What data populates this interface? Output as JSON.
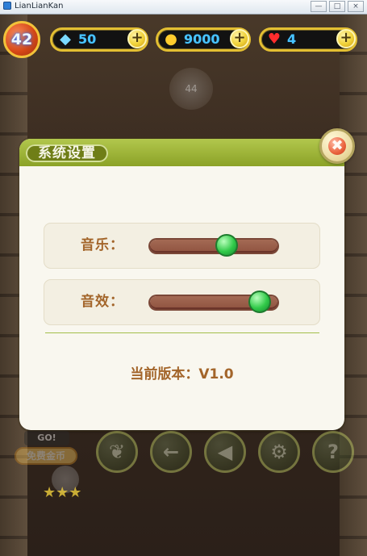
{
  "window": {
    "title": "LianLianKan",
    "minimize_label": "—",
    "maximize_label": "□",
    "close_label": "×"
  },
  "hud": {
    "level": "42",
    "gems": "50",
    "coins": "9000",
    "lives": "4",
    "plus_symbol": "+"
  },
  "background": {
    "hint_value": "44"
  },
  "dialog": {
    "title": "系统设置",
    "music_label": "音乐：",
    "sound_label": "音效：",
    "music_level": 0.6,
    "sound_level": 0.86,
    "version_text": "当前版本：V1.0",
    "close_symbol": "✖"
  },
  "bottom": {
    "go_text": "GO!",
    "free_coins_text": "免费金币",
    "stars": "★★★",
    "icons": [
      "leaf-icon",
      "arrow-left-icon",
      "sound-icon",
      "gear-icon",
      "question-icon"
    ]
  }
}
